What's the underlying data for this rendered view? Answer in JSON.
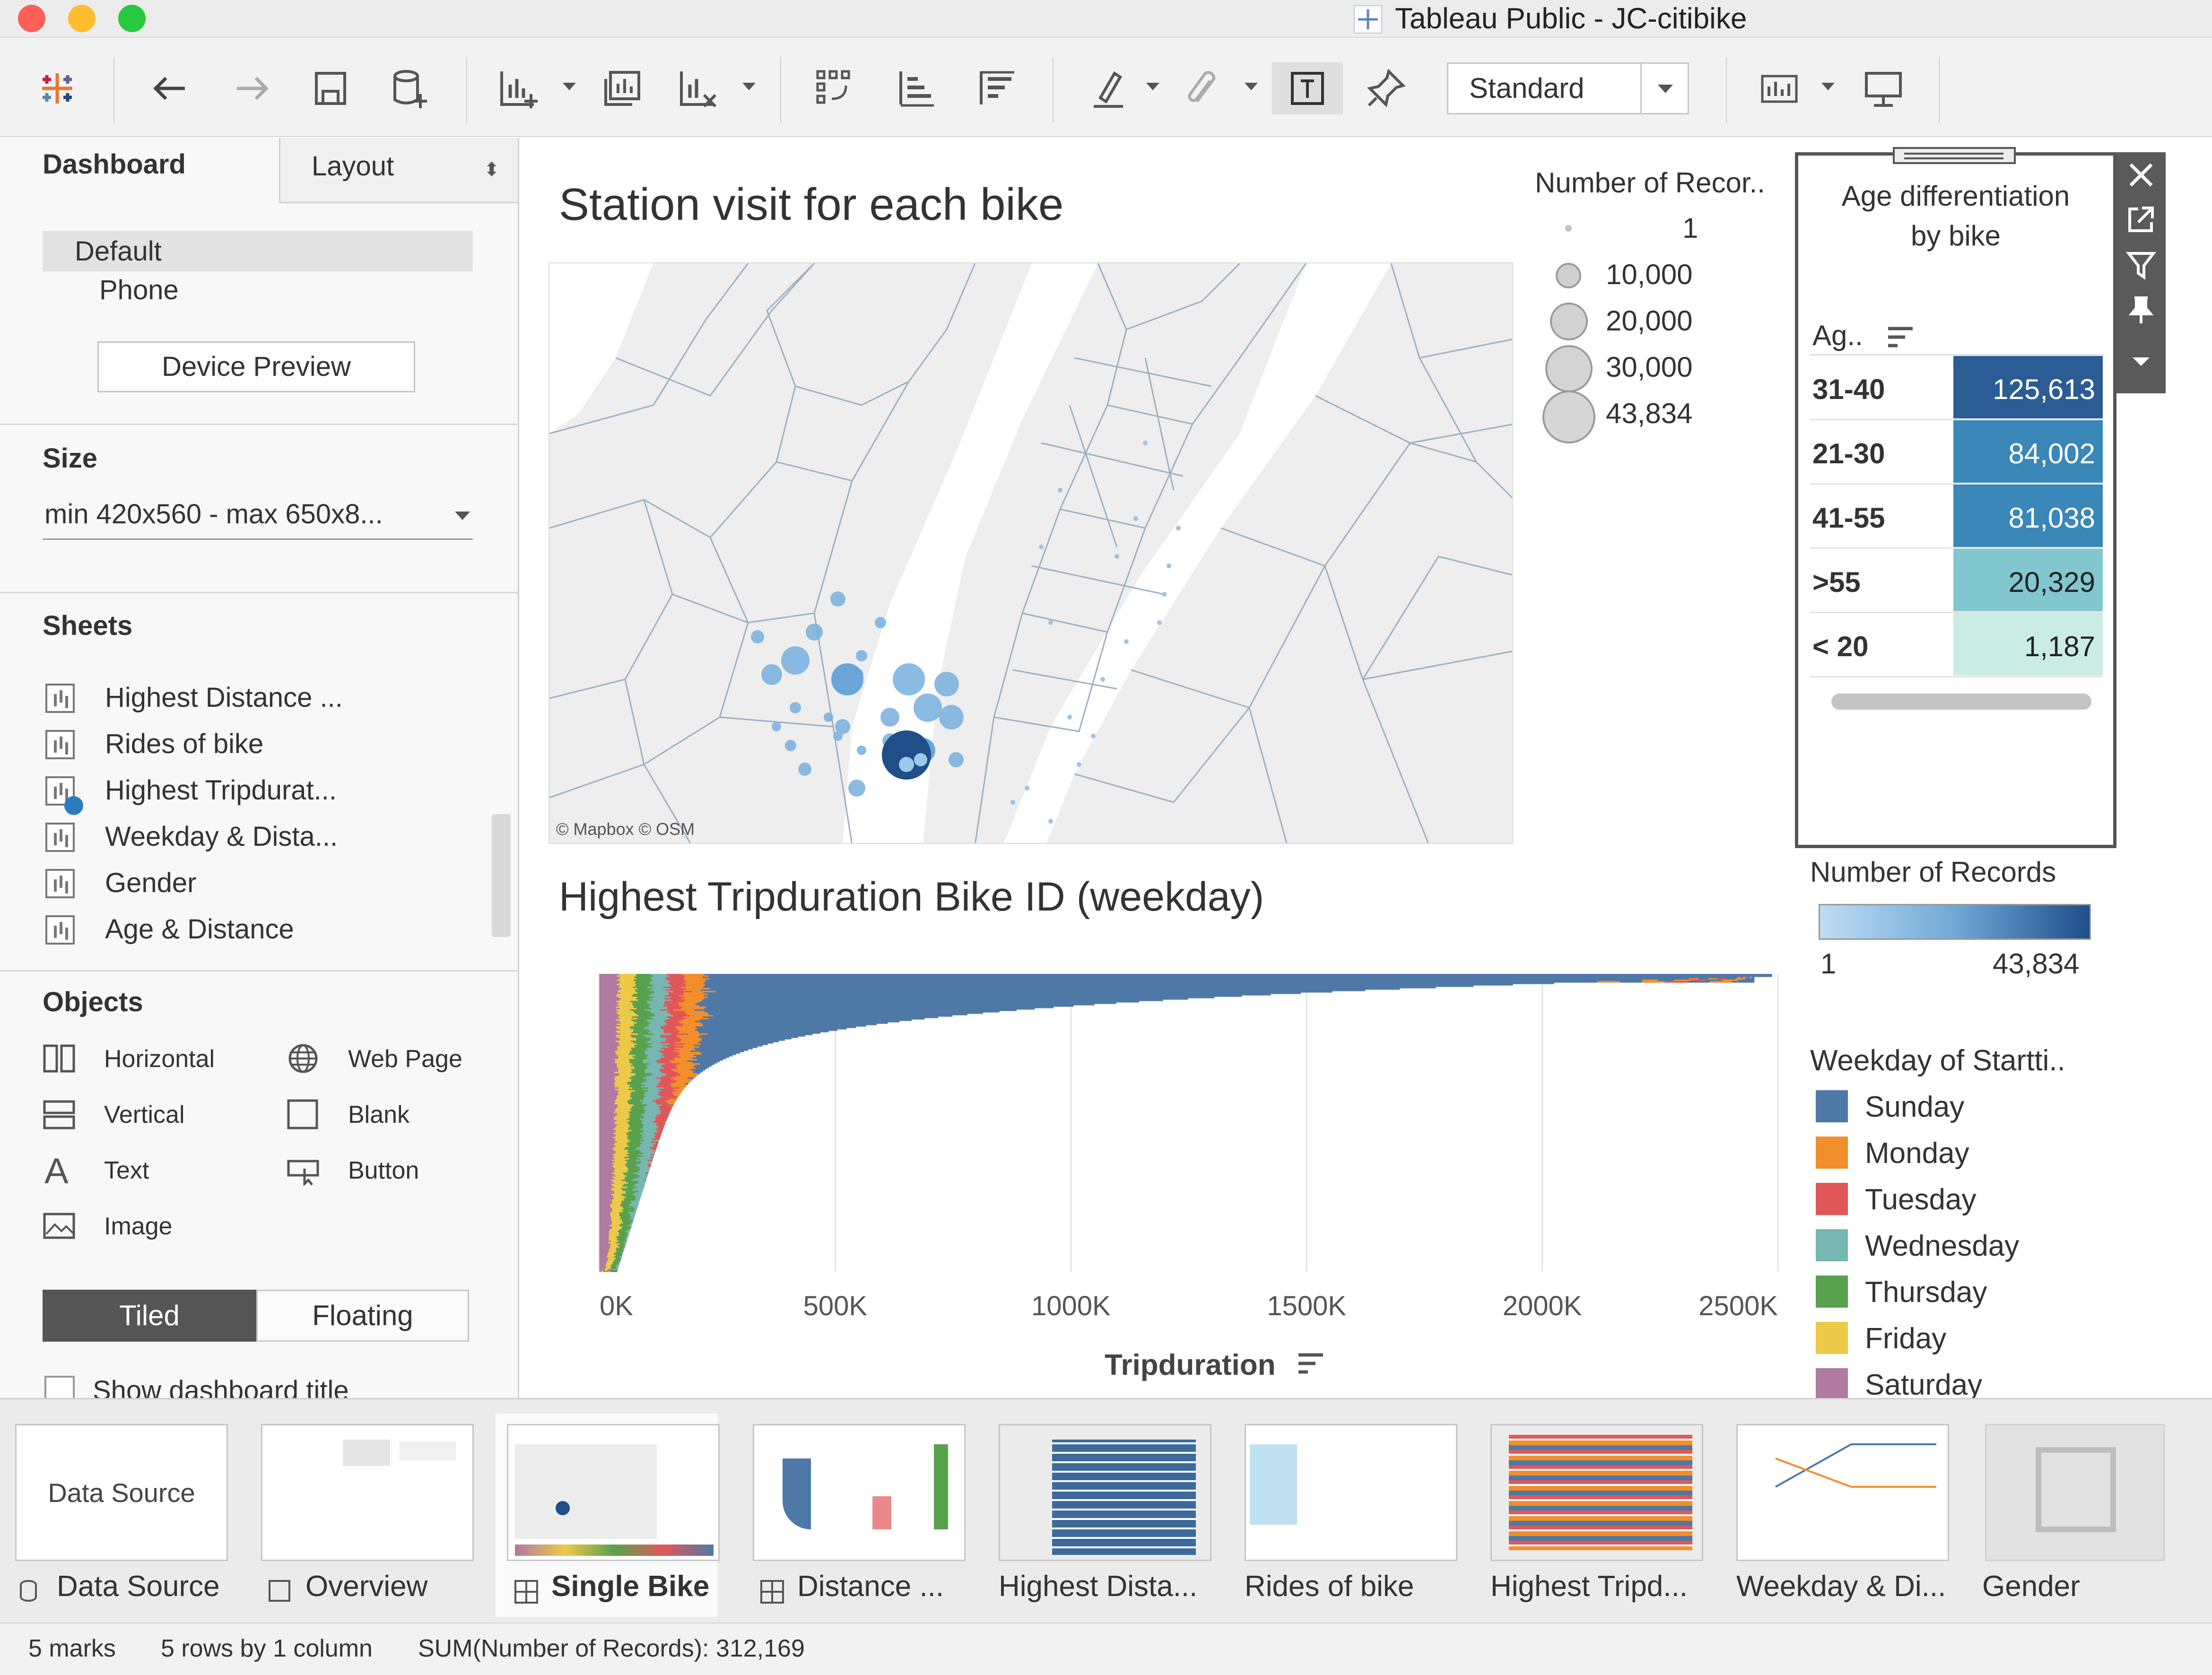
{
  "window": {
    "title": "Tableau Public - JC-citibike"
  },
  "toolbar": {
    "view_mode": "Standard"
  },
  "left_panel": {
    "tabs": {
      "dashboard": "Dashboard",
      "layout": "Layout"
    },
    "devices": [
      "Default",
      "Phone"
    ],
    "device_preview_button": "Device Preview",
    "size": {
      "heading": "Size",
      "value": "min 420x560 - max 650x8..."
    },
    "sheets": {
      "heading": "Sheets",
      "items": [
        "Highest Distance ...",
        "Rides of bike",
        "Highest Tripdurat...",
        "Weekday & Dista...",
        "Gender",
        "Age & Distance"
      ]
    },
    "objects": {
      "heading": "Objects",
      "items": [
        "Horizontal",
        "Web Page",
        "Vertical",
        "Blank",
        "Text",
        "Button",
        "Image"
      ]
    },
    "layout_toggle": {
      "tiled": "Tiled",
      "floating": "Floating"
    },
    "show_title": "Show dashboard title"
  },
  "dashboard": {
    "map": {
      "title": "Station visit for each bike",
      "attribution": "© Mapbox © OSM",
      "legend_title": "Number of Recor..",
      "legend_items": [
        "1",
        "10,000",
        "20,000",
        "30,000",
        "43,834"
      ]
    },
    "age_panel": {
      "title_line1": "Age differentiation",
      "title_line2": "by bike",
      "column_header": "Ag..",
      "rows": [
        {
          "label": "31-40",
          "value": "125,613",
          "color": "#2b5d94"
        },
        {
          "label": "21-30",
          "value": "84,002",
          "color": "#3a87b8"
        },
        {
          "label": "41-55",
          "value": "81,038",
          "color": "#3a87b8"
        },
        {
          "label": ">55",
          "value": "20,329",
          "color": "#82c7cf"
        },
        {
          "label": "< 20",
          "value": "1,187",
          "color": "#c9ece4"
        }
      ]
    },
    "records_legend": {
      "title": "Number of Records",
      "min": "1",
      "max": "43,834"
    },
    "weekday_legend": {
      "title": "Weekday of Startti..",
      "items": [
        {
          "label": "Sunday",
          "color": "#4e79a7"
        },
        {
          "label": "Monday",
          "color": "#f28e2b"
        },
        {
          "label": "Tuesday",
          "color": "#e15759"
        },
        {
          "label": "Wednesday",
          "color": "#76b7b2"
        },
        {
          "label": "Thursday",
          "color": "#59a14f"
        },
        {
          "label": "Friday",
          "color": "#edc948"
        },
        {
          "label": "Saturday",
          "color": "#b07aa1"
        }
      ]
    }
  },
  "chart_data": {
    "type": "bar",
    "title": "Highest Tripduration Bike ID (weekday)",
    "xlabel": "Tripduration",
    "ylabel": "",
    "xlim": [
      0,
      2500000
    ],
    "x_ticks": [
      "0K",
      "500K",
      "1000K",
      "1500K",
      "2000K",
      "2500K"
    ],
    "orientation": "horizontal-stacked",
    "series": [
      {
        "name": "Sunday",
        "color": "#4e79a7"
      },
      {
        "name": "Monday",
        "color": "#f28e2b"
      },
      {
        "name": "Tuesday",
        "color": "#e15759"
      },
      {
        "name": "Wednesday",
        "color": "#76b7b2"
      },
      {
        "name": "Thursday",
        "color": "#59a14f"
      },
      {
        "name": "Friday",
        "color": "#edc948"
      },
      {
        "name": "Saturday",
        "color": "#b07aa1"
      }
    ],
    "grid": true
  },
  "tabs": [
    {
      "label": "Data Source",
      "thumb_text": "Data Source",
      "active": false
    },
    {
      "label": "Overview",
      "active": false
    },
    {
      "label": "Single Bike",
      "active": true
    },
    {
      "label": "Distance ...",
      "active": false
    },
    {
      "label": "Highest Dista...",
      "active": false
    },
    {
      "label": "Rides of bike",
      "active": false
    },
    {
      "label": "Highest Tripd...",
      "active": false
    },
    {
      "label": "Weekday & Di...",
      "active": false
    },
    {
      "label": "Gender",
      "active": false
    }
  ],
  "status": {
    "marks": "5 marks",
    "rows": "5 rows by 1 column",
    "sum": "SUM(Number of Records): 312,169"
  }
}
